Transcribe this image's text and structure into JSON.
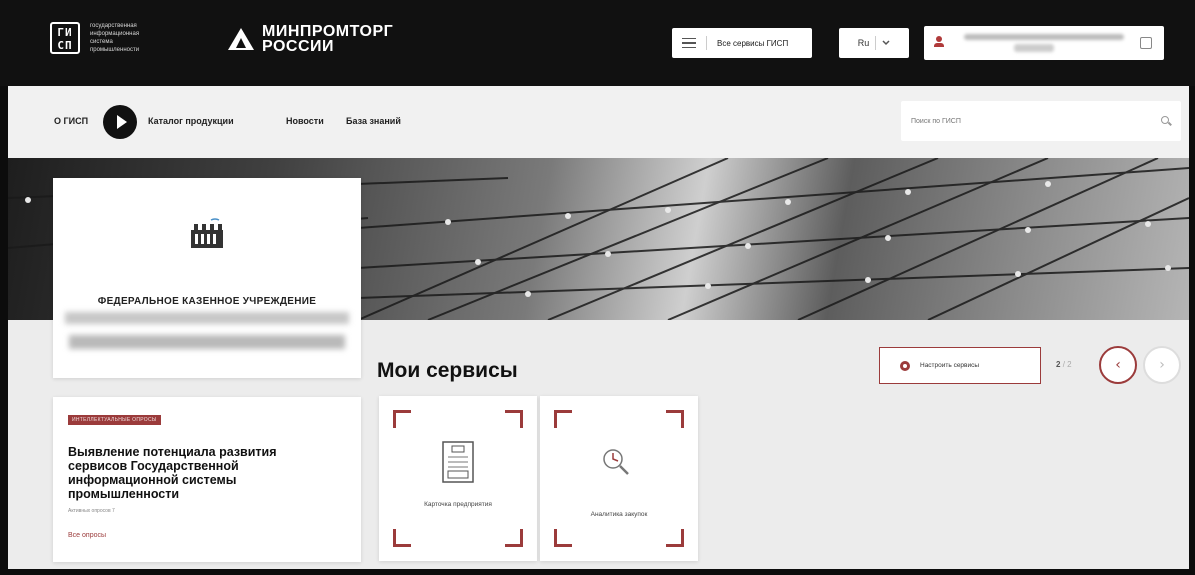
{
  "header": {
    "gisp_mark": "ГИ СП",
    "gisp_text": "государственная информационная система промышленности",
    "ministry_line1": "МИНПРОМТОРГ",
    "ministry_line2": "РОССИИ",
    "all_services_label": "Все сервисы ГИСП",
    "lang_label": "Ru"
  },
  "nav": {
    "items": [
      {
        "label": "О ГИСП"
      },
      {
        "label": "Каталог продукции"
      },
      {
        "label": "Новости"
      },
      {
        "label": "База знаний"
      }
    ],
    "search_placeholder": "Поиск по ГИСП"
  },
  "org_card": {
    "title": "ФЕДЕРАЛЬНОЕ КАЗЕННОЕ УЧРЕЖДЕНИЕ"
  },
  "survey": {
    "tag": "ИНТЕЛЛЕКТУАЛЬНЫЕ ОПРОСЫ",
    "title": "Выявление потенциала развития сервисов Государственной информационной системы промышленности",
    "subtitle": "Активных опросов 7",
    "link": "Все опросы"
  },
  "services": {
    "title": "Мои сервисы",
    "configure_label": "Настроить сервисы",
    "pager_current": "2",
    "pager_total": "/ 2",
    "prev_symbol": "‹",
    "next_symbol": "›",
    "tiles": [
      {
        "label": "Карточка предприятия",
        "icon": "document-icon"
      },
      {
        "label": "Аналитика закупок",
        "icon": "analytics-icon"
      }
    ]
  },
  "colors": {
    "accent": "#9b3b3b",
    "topbar": "#111111",
    "nav_bg": "#f1f1f1",
    "content_bg": "#ececec"
  }
}
